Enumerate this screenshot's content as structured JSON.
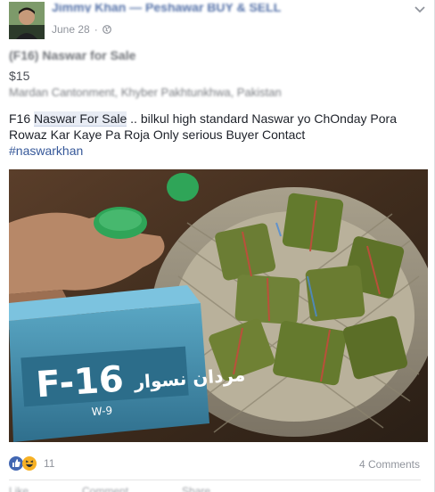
{
  "post": {
    "author": "Jimmy Khan — Peshawar BUY & SELL",
    "date": "June 28",
    "privacy_icon": "globe-icon",
    "sale_title": "(F16) Naswar for Sale",
    "price": "$15",
    "location": "Mardan Cantonment, Khyber Pakhtunkhwa, Pakistan",
    "text_prefix": "F16 ",
    "text_highlight": "Naswar For Sale",
    "text_rest": " .. bilkul high standard Naswar yo ChOnday Pora Rowaz Kar Kaye Pa Roja Only serious Buyer Contact",
    "hashtag": "#naswarkhan"
  },
  "photo": {
    "box_title": "F-16",
    "box_urdu": "مردان نسوار",
    "box_sub": "W-9"
  },
  "footer": {
    "reaction_count": "11",
    "comments": "4 Comments",
    "like_label": "Like",
    "comment_label": "Comment",
    "share_label": "Share"
  },
  "colors": {
    "link": "#365899",
    "meta": "#90949c",
    "like": "#4267b2",
    "haha": "#f7b125"
  }
}
